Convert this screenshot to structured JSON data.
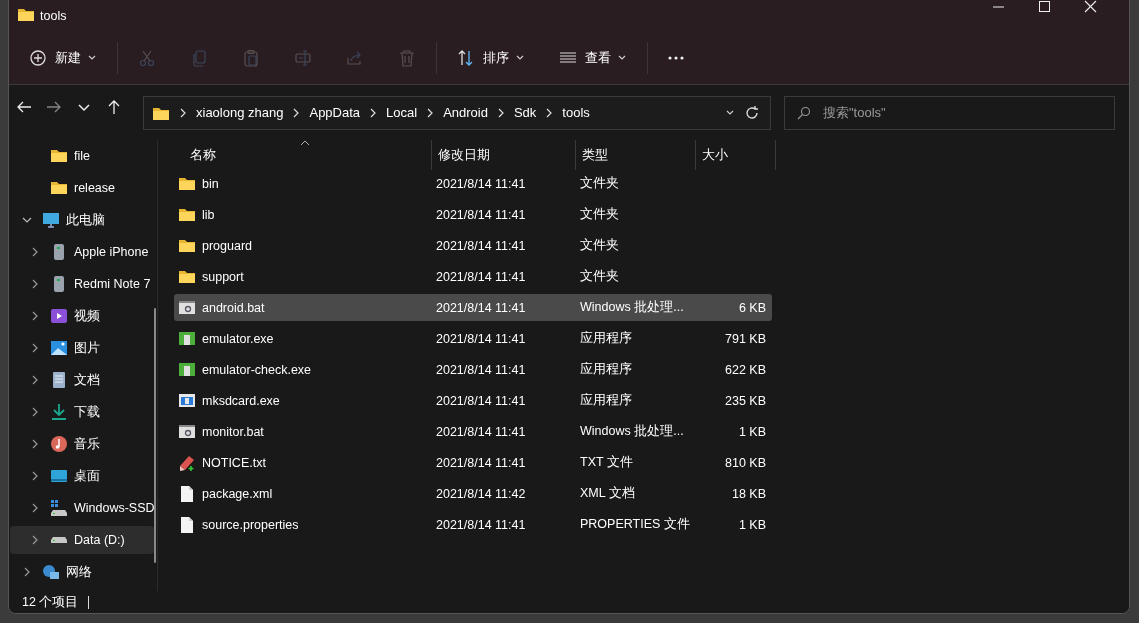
{
  "window": {
    "title": "tools"
  },
  "toolbar": [
    {
      "kind": "new",
      "label": "新建",
      "disabled": false
    },
    {
      "kind": "cut",
      "disabled": true
    },
    {
      "kind": "copy",
      "disabled": true
    },
    {
      "kind": "paste",
      "disabled": true
    },
    {
      "kind": "rename",
      "disabled": true
    },
    {
      "kind": "share",
      "disabled": true
    },
    {
      "kind": "delete",
      "disabled": true
    },
    {
      "kind": "sort",
      "label": "排序",
      "disabled": false
    },
    {
      "kind": "view",
      "label": "查看",
      "disabled": false
    },
    {
      "kind": "more",
      "disabled": false
    }
  ],
  "navigation": {
    "back_disabled": false,
    "forward_disabled": true
  },
  "address": {
    "segments": [
      "xiaolong zhang",
      "AppData",
      "Local",
      "Android",
      "Sdk",
      "tools"
    ]
  },
  "search": {
    "placeholder": "搜索\"tools\""
  },
  "sidebar": {
    "items": [
      {
        "label": "file",
        "kind": "folder",
        "selected": false
      },
      {
        "label": "release",
        "kind": "folder",
        "selected": false
      },
      {
        "label": "此电脑",
        "kind": "pc",
        "expanded": true,
        "selected": false,
        "children": [
          {
            "label": "Apple iPhone",
            "kind": "phone",
            "expanded": false,
            "selected": false
          },
          {
            "label": "Redmi Note 7",
            "kind": "phone",
            "expanded": false,
            "selected": false
          },
          {
            "label": "视频",
            "kind": "video",
            "expanded": false,
            "selected": false
          },
          {
            "label": "图片",
            "kind": "pictures",
            "expanded": false,
            "selected": false
          },
          {
            "label": "文档",
            "kind": "documents",
            "expanded": false,
            "selected": false
          },
          {
            "label": "下载",
            "kind": "download",
            "expanded": false,
            "selected": false
          },
          {
            "label": "音乐",
            "kind": "music",
            "expanded": false,
            "selected": false
          },
          {
            "label": "桌面",
            "kind": "desktop",
            "expanded": false,
            "selected": false
          },
          {
            "label": "Windows-SSD",
            "kind": "system-drive",
            "expanded": false,
            "selected": false
          },
          {
            "label": "Data (D:)",
            "kind": "drive",
            "expanded": false,
            "selected": true
          }
        ]
      },
      {
        "label": "网络",
        "kind": "network",
        "expanded": false,
        "selected": false
      }
    ]
  },
  "table": {
    "columns": [
      {
        "label": "名称",
        "sorted": true
      },
      {
        "label": "修改日期"
      },
      {
        "label": "类型"
      },
      {
        "label": "大小"
      }
    ],
    "rows": [
      {
        "kind": "folder",
        "name": "bin",
        "date": "2021/8/14 11:41",
        "type": "文件夹",
        "selected": false
      },
      {
        "kind": "folder",
        "name": "lib",
        "date": "2021/8/14 11:41",
        "type": "文件夹",
        "selected": false
      },
      {
        "kind": "folder",
        "name": "proguard",
        "date": "2021/8/14 11:41",
        "type": "文件夹",
        "selected": false
      },
      {
        "kind": "folder",
        "name": "support",
        "date": "2021/8/14 11:41",
        "type": "文件夹",
        "selected": false
      },
      {
        "kind": "batch",
        "name": "android.bat",
        "date": "2021/8/14 11:41",
        "type": "Windows 批处理...",
        "size": "6 KB",
        "selected": true
      },
      {
        "kind": "app",
        "name": "emulator.exe",
        "date": "2021/8/14 11:41",
        "type": "应用程序",
        "size": "791 KB",
        "selected": false
      },
      {
        "kind": "app",
        "name": "emulator-check.exe",
        "date": "2021/8/14 11:41",
        "type": "应用程序",
        "size": "622 KB",
        "selected": false
      },
      {
        "kind": "app-window",
        "name": "mksdcard.exe",
        "date": "2021/8/14 11:41",
        "type": "应用程序",
        "size": "235 KB",
        "selected": false
      },
      {
        "kind": "batch",
        "name": "monitor.bat",
        "date": "2021/8/14 11:41",
        "type": "Windows 批处理...",
        "size": "1 KB",
        "selected": false
      },
      {
        "kind": "text",
        "name": "NOTICE.txt",
        "date": "2021/8/14 11:41",
        "type": "TXT 文件",
        "size": "810 KB",
        "selected": false
      },
      {
        "kind": "document",
        "name": "package.xml",
        "date": "2021/8/14 11:42",
        "type": "XML 文档",
        "size": "18 KB",
        "selected": false
      },
      {
        "kind": "document",
        "name": "source.properties",
        "date": "2021/8/14 11:41",
        "type": "PROPERTIES 文件",
        "size": "1 KB",
        "selected": false
      }
    ]
  },
  "status_bar": {
    "count": "12 个项目"
  }
}
